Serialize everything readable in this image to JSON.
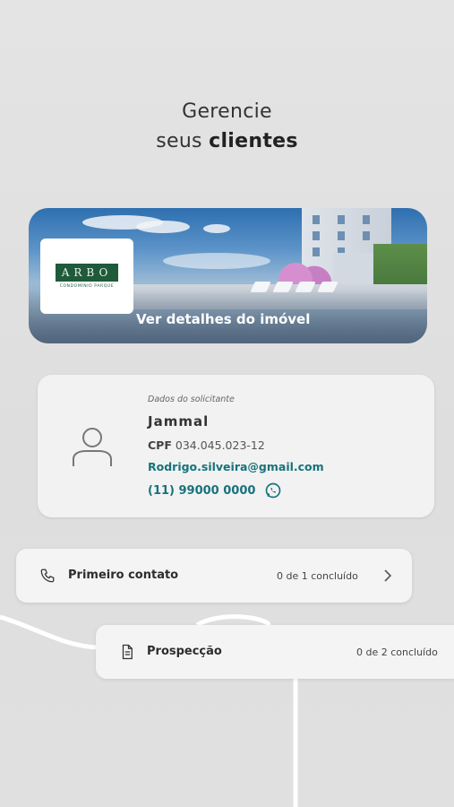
{
  "headline": {
    "line1": "Gerencie",
    "line2_regular": "seus",
    "line2_bold": "clientes"
  },
  "property": {
    "logo_text": "ARBO",
    "logo_subtitle": "CONDOMÍNIO PARQUE",
    "cta": "Ver detalhes do imóvel"
  },
  "client": {
    "section_label": "Dados do solicitante",
    "name": "Jammal",
    "cpf_label": "CPF",
    "cpf": "034.045.023-12",
    "email": "Rodrigo.silveira@gmail.com",
    "phone": "(11) 99000 0000"
  },
  "stages": [
    {
      "title": "Primeiro contato",
      "status": "0 de 1 concluído",
      "icon": "phone-icon"
    },
    {
      "title": "Prospecção",
      "status": "0 de 2 concluído",
      "icon": "document-icon"
    }
  ],
  "colors": {
    "accent": "#17737a",
    "brand_green": "#1f5a3a",
    "background": "#e3e3e3"
  }
}
